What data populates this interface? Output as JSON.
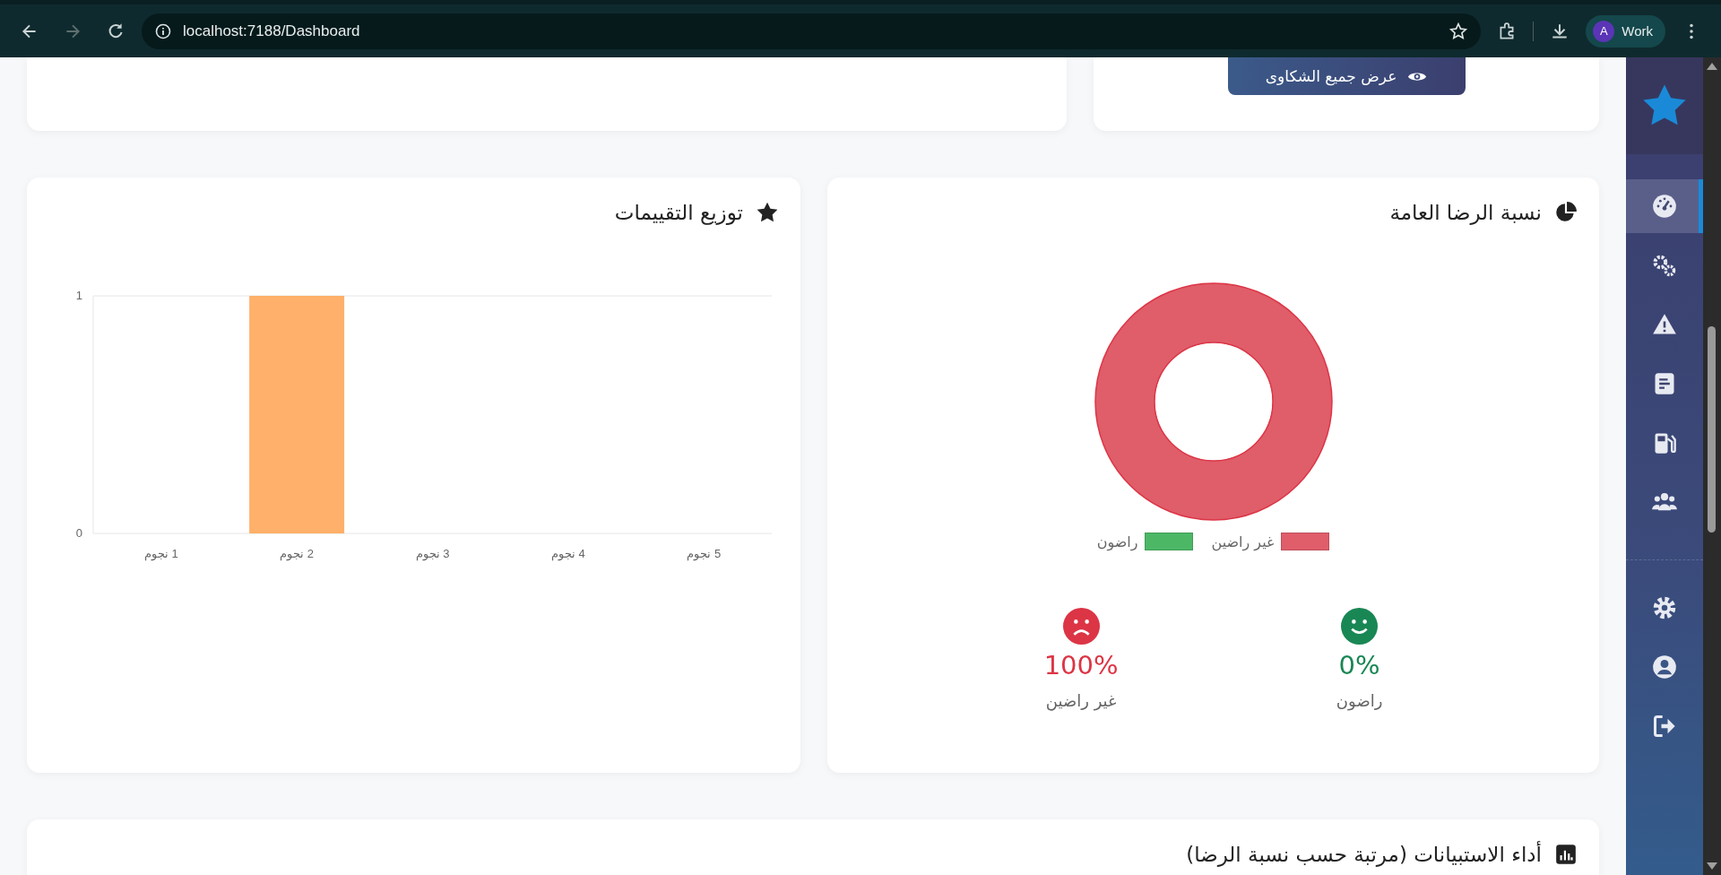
{
  "browser": {
    "url": "localhost:7188/Dashboard",
    "profile_initial": "A",
    "profile_name": "Work",
    "forward_disabled": true
  },
  "complaints_button": {
    "label": "عرض جميع الشكاوى"
  },
  "ratings_card": {
    "title": "توزيع التقييمات",
    "chart_data": {
      "type": "bar",
      "categories": [
        "1 نجوم",
        "2 نجوم",
        "3 نجوم",
        "4 نجوم",
        "5 نجوم"
      ],
      "series": [
        {
          "color": "#ffb06a",
          "values": [
            0,
            1,
            0,
            0,
            0
          ]
        }
      ],
      "ylim": [
        0,
        1
      ],
      "yticks": [
        0,
        1
      ]
    }
  },
  "satisfaction_card": {
    "title": "نسبة الرضا العامة",
    "chart_data": {
      "type": "donut",
      "categories": [
        "راضون",
        "غير راضين"
      ],
      "series": [
        {
          "values": [
            0,
            100
          ]
        }
      ],
      "colors": [
        "#4cb866",
        "#e05d6a"
      ]
    },
    "stats": [
      {
        "kind": "happy",
        "value": "0%",
        "label": "راضون",
        "color": "#198754"
      },
      {
        "kind": "sad",
        "value": "100%",
        "label": "غير راضين",
        "color": "#dc3545"
      }
    ]
  },
  "surveys_card": {
    "title": "أداء الاستبيانات (مرتبة حسب نسبة الرضا)"
  },
  "sidebar": {
    "items": [
      {
        "selected": true
      },
      {
        "selected": false
      },
      {
        "selected": false
      },
      {
        "selected": false
      },
      {
        "selected": false
      },
      {
        "selected": false
      }
    ],
    "bottom_items": [
      {
        "selected": false
      },
      {
        "selected": false
      },
      {
        "selected": false
      }
    ]
  }
}
